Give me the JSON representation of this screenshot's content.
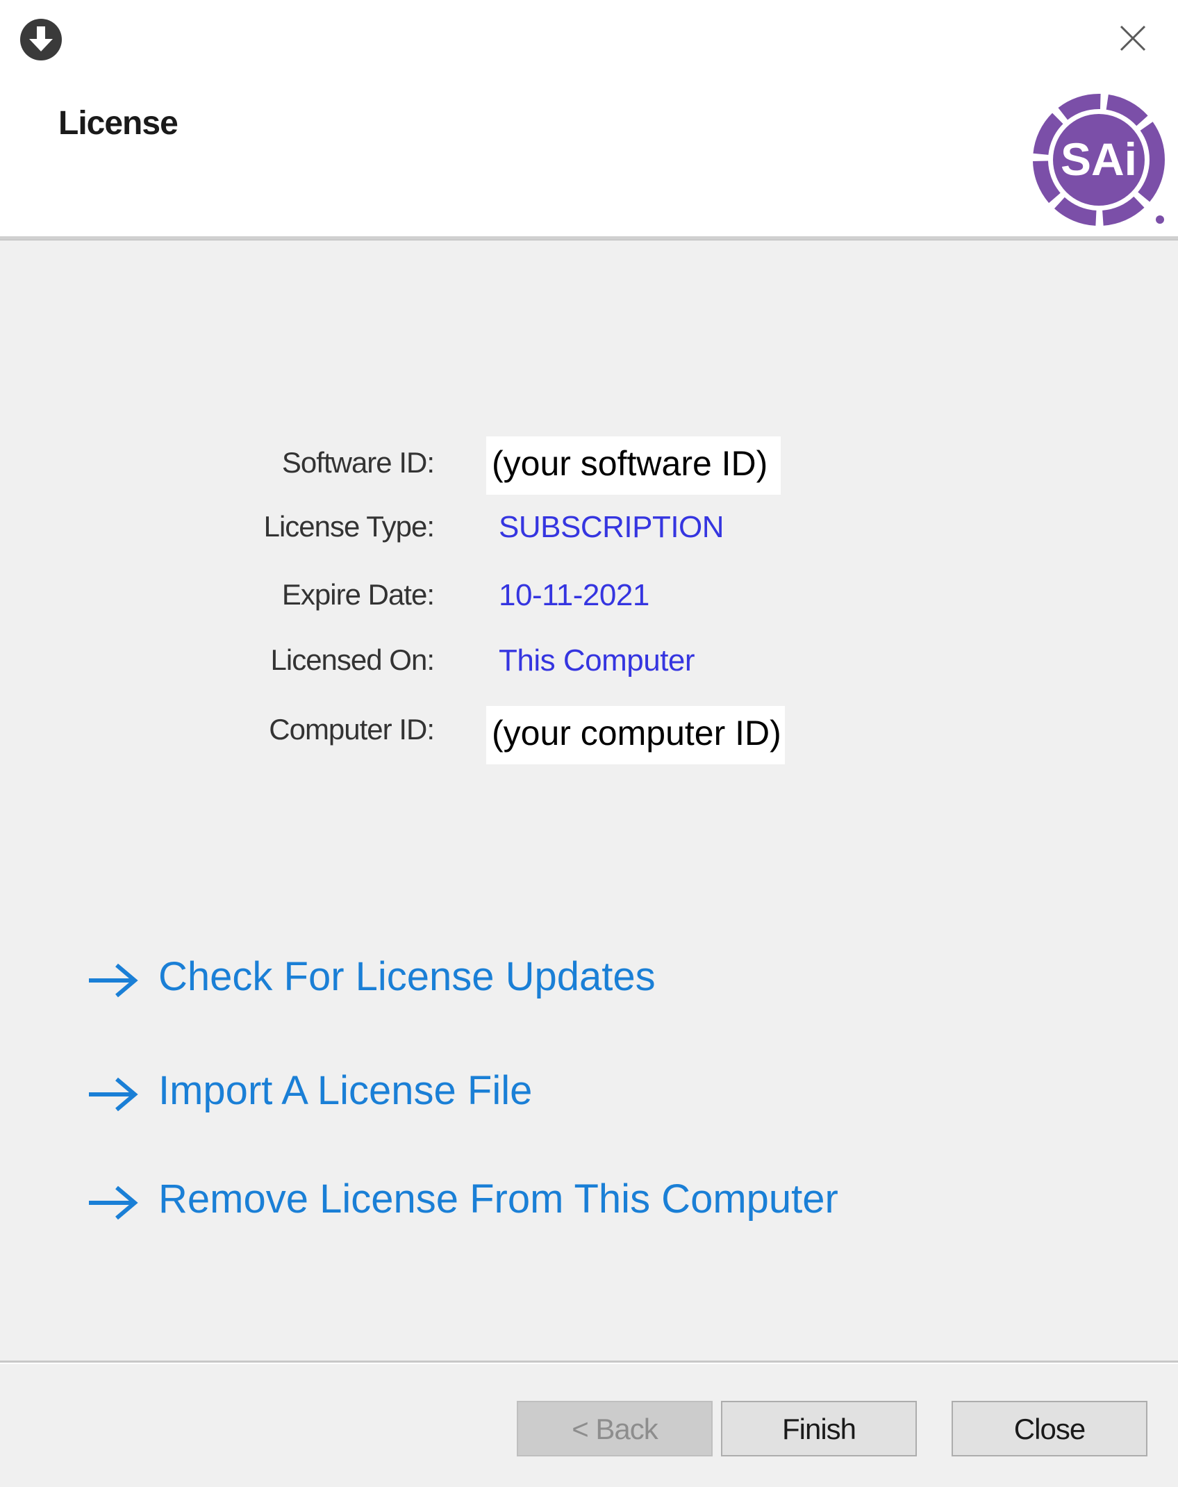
{
  "window": {
    "title": "License",
    "app_icon": "download-circle-icon",
    "close_icon": "close-icon"
  },
  "brand": {
    "logo_text": "SAi",
    "logo_color": "#7b4fa8"
  },
  "info": {
    "software_id_label": "Software ID:",
    "software_id_value": "(your software ID)",
    "license_type_label": "License Type:",
    "license_type_value": "SUBSCRIPTION",
    "expire_date_label": "Expire Date:",
    "expire_date_value": "10-11-2021",
    "licensed_on_label": "Licensed On:",
    "licensed_on_value": "This Computer",
    "computer_id_label": "Computer ID:",
    "computer_id_value": "(your computer ID)",
    "value_color": "#3535e0"
  },
  "links": [
    {
      "label": "Check For License Updates",
      "icon": "arrow-right-icon"
    },
    {
      "label": "Import A License File",
      "icon": "arrow-right-icon"
    },
    {
      "label": "Remove License From This Computer",
      "icon": "arrow-right-icon"
    }
  ],
  "link_color": "#1a7fd6",
  "buttons": {
    "back": "< Back",
    "finish": "Finish",
    "close": "Close"
  }
}
